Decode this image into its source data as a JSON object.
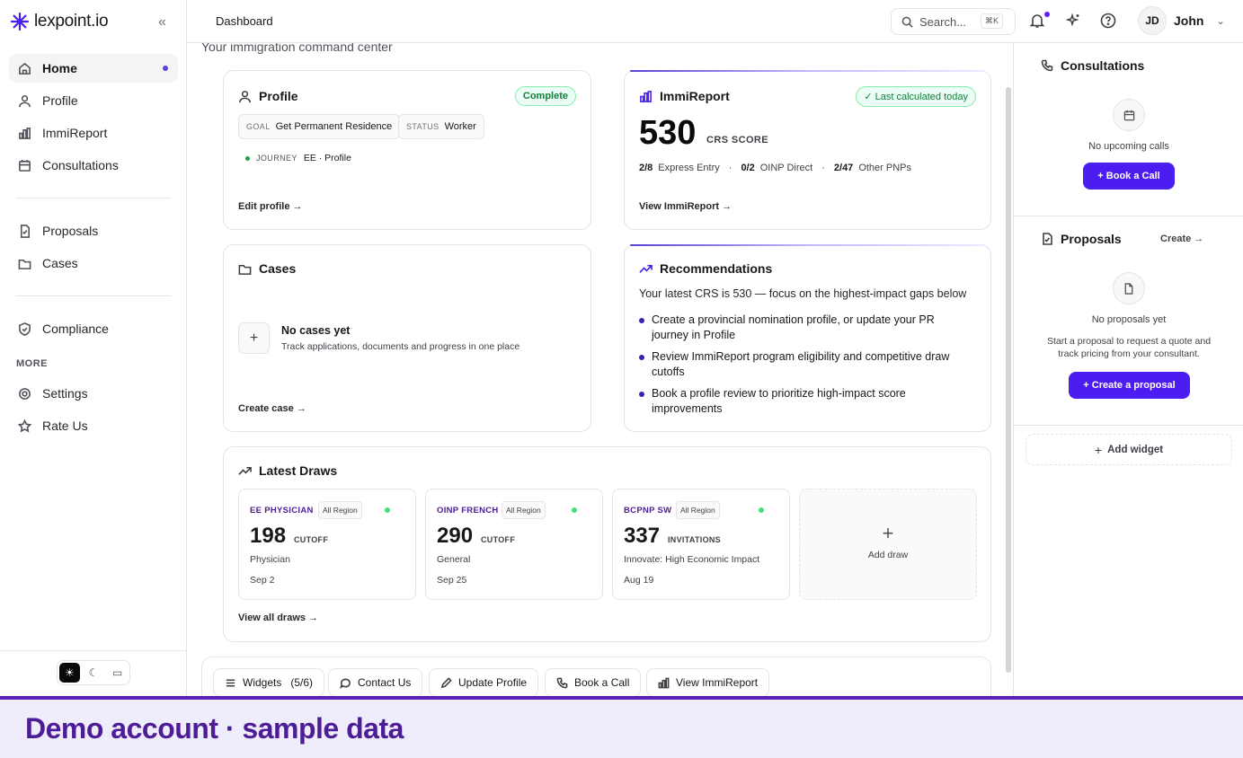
{
  "app": {
    "name": "lexpoint.io"
  },
  "sidebar": {
    "items": [
      {
        "label": "Home"
      },
      {
        "label": "Profile"
      },
      {
        "label": "ImmiReport"
      },
      {
        "label": "Consultations"
      },
      {
        "label": "Proposals"
      },
      {
        "label": "Cases"
      },
      {
        "label": "Compliance"
      }
    ],
    "more_label": "MORE",
    "more_items": [
      {
        "label": "Settings"
      },
      {
        "label": "Rate Us"
      }
    ]
  },
  "header": {
    "breadcrumb": "Dashboard",
    "search_placeholder": "Search...",
    "search_shortcut": "⌘K",
    "user_initials": "JD",
    "user_name": "John"
  },
  "main": {
    "subtitle": "Your immigration command center",
    "profile": {
      "title": "Profile",
      "badge": "Complete",
      "goal_key": "GOAL",
      "goal_value": "Get Permanent Residence",
      "status_key": "STATUS",
      "status_value": "Worker",
      "journey_key": "JOURNEY",
      "journey_value": "EE · Profile",
      "link": "Edit profile →"
    },
    "immireport": {
      "title": "ImmiReport",
      "badge": "✓ Last calculated today",
      "score": "530",
      "score_label": "CRS SCORE",
      "ee_value": "2/8",
      "ee_label": "Express Entry",
      "oinp_value": "0/2",
      "oinp_label": "OINP Direct",
      "pnp_value": "2/47",
      "pnp_label": "Other PNPs",
      "sep": "·",
      "link": "View ImmiReport →"
    },
    "cases": {
      "title": "Cases",
      "empty_title": "No cases yet",
      "empty_sub": "Track applications, documents and progress in one place",
      "link": "Create case →"
    },
    "recommendations": {
      "title": "Recommendations",
      "intro": "Your latest CRS is 530 — focus on the highest-impact gaps below",
      "items": [
        "Create a provincial nomination profile, or update your PR journey in Profile",
        "Review ImmiReport program eligibility and competitive draw cutoffs",
        "Book a profile review to prioritize high-impact score improvements"
      ]
    },
    "draws": {
      "title": "Latest Draws",
      "items": [
        {
          "name": "EE PHYSICIAN",
          "region": "All Region",
          "value": "198",
          "unit": "CUTOFF",
          "sub": "Physician",
          "date": "Sep 2"
        },
        {
          "name": "OINP FRENCH",
          "region": "All Region",
          "value": "290",
          "unit": "CUTOFF",
          "sub": "General",
          "date": "Sep 25"
        },
        {
          "name": "BCPNP SW",
          "region": "All Region",
          "value": "337",
          "unit": "INVITATIONS",
          "sub": "Innovate: High Economic Impact",
          "date": "Aug 19"
        }
      ],
      "add_label": "Add draw",
      "link": "View all draws →"
    },
    "quick_actions": [
      {
        "label": "Widgets",
        "extra": "(5/6)"
      },
      {
        "label": "Contact Us"
      },
      {
        "label": "Update Profile"
      },
      {
        "label": "Book a Call"
      },
      {
        "label": "View ImmiReport"
      }
    ]
  },
  "right_panel": {
    "consultations": {
      "title": "Consultations",
      "empty": "No upcoming calls",
      "button": "+ Book a Call"
    },
    "proposals": {
      "title": "Proposals",
      "create_link": "Create →",
      "empty": "No proposals yet",
      "desc_line1": "Start a proposal to request a quote and",
      "desc_line2": "track pricing from your consultant.",
      "button": "+ Create a proposal"
    },
    "add_widget": "Add widget"
  },
  "banner": {
    "text": "Demo account · sample data"
  },
  "colors": {
    "accent": "#4c1df0",
    "banner_text": "#4c1d95",
    "success": "#15803d"
  }
}
